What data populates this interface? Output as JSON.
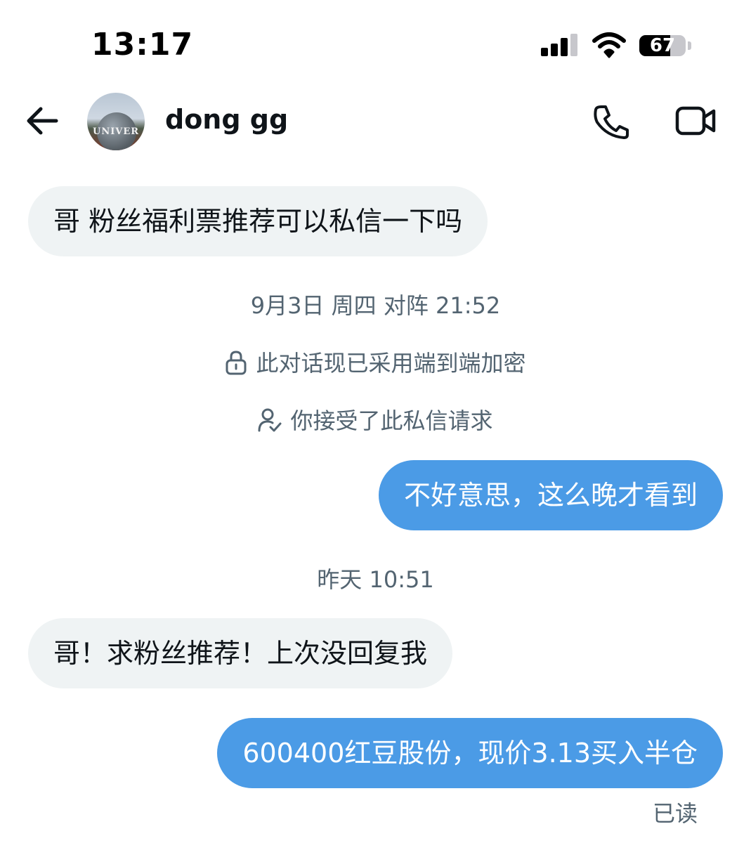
{
  "status_bar": {
    "time": "13:17",
    "battery_level": "67",
    "battery_fraction": 0.67
  },
  "header": {
    "back_icon": "arrow-left-icon",
    "contact_name": "dong gg",
    "avatar_text": "UNIVER",
    "phone_icon": "phone-icon",
    "video_icon": "video-camera-icon"
  },
  "messages": [
    {
      "type": "incoming",
      "text": "哥 粉丝福利票推荐可以私信一下吗"
    },
    {
      "type": "timestamp",
      "text": "9月3日 周四 对阵 21:52"
    },
    {
      "type": "system",
      "icon": "lock-icon",
      "text": "此对话现已采用端到端加密"
    },
    {
      "type": "system",
      "icon": "user-check-icon",
      "text": "你接受了此私信请求"
    },
    {
      "type": "outgoing",
      "text": "不好意思，这么晚才看到"
    },
    {
      "type": "timestamp",
      "text": "昨天 10:51"
    },
    {
      "type": "incoming",
      "text": "哥！求粉丝推荐！上次没回复我"
    },
    {
      "type": "outgoing",
      "text": "600400红豆股份，现价3.13买入半仓"
    }
  ],
  "read_receipt": "已读",
  "colors": {
    "outgoing_bubble": "#4b9be6",
    "incoming_bubble": "#eff3f4",
    "secondary_text": "#536471"
  }
}
